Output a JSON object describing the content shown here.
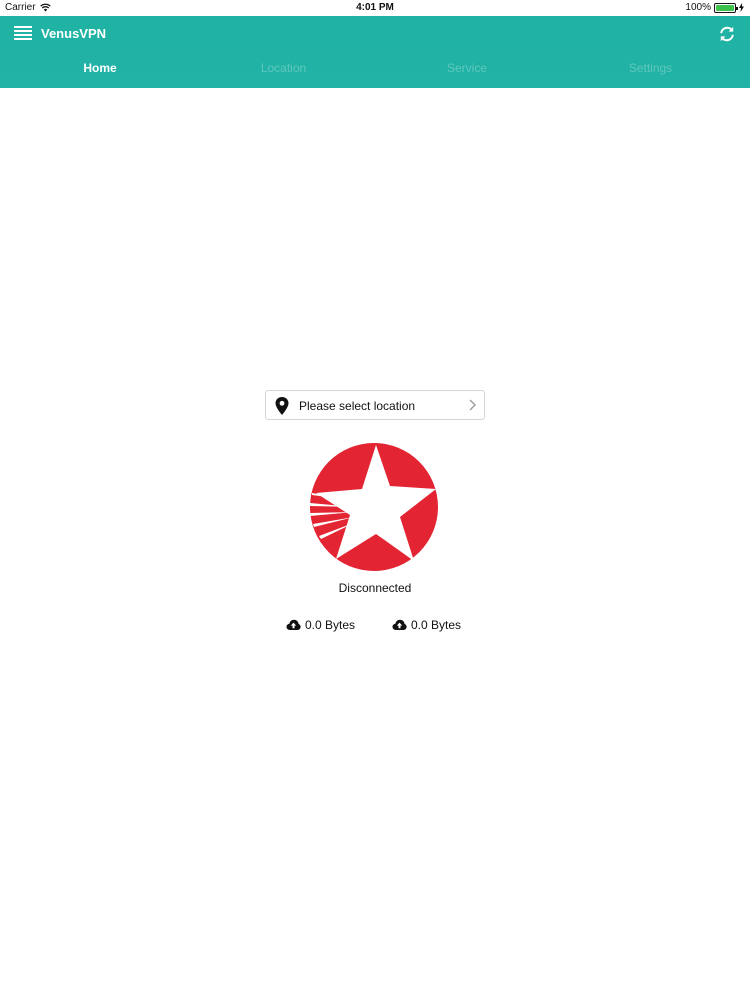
{
  "status_bar": {
    "carrier": "Carrier",
    "time": "4:01 PM",
    "battery": "100%",
    "battery_level": 1.0,
    "icons": [
      "wifi-icon",
      "battery-icon",
      "charging-icon"
    ]
  },
  "navbar": {
    "title": "VenusVPN",
    "menu_icon": "menu-icon",
    "refresh_icon": "refresh-icon",
    "background_color": "#20b2a5",
    "tabs": [
      {
        "label": "Home",
        "active": true
      },
      {
        "label": "Location",
        "active": false
      },
      {
        "label": "Service",
        "active": false
      },
      {
        "label": "Settings",
        "active": false
      }
    ]
  },
  "main": {
    "location_select": {
      "placeholder": "Please select location",
      "icon": "location-pin-icon",
      "chevron": "chevron-right-icon"
    },
    "connect_button": {
      "icon": "star-logo-icon",
      "color": "#e32432"
    },
    "connection_status": "Disconnected",
    "stats": [
      {
        "icon": "cloud-upload-icon",
        "value": "0.0 Bytes"
      },
      {
        "icon": "cloud-upload-icon",
        "value": "0.0 Bytes"
      }
    ]
  }
}
